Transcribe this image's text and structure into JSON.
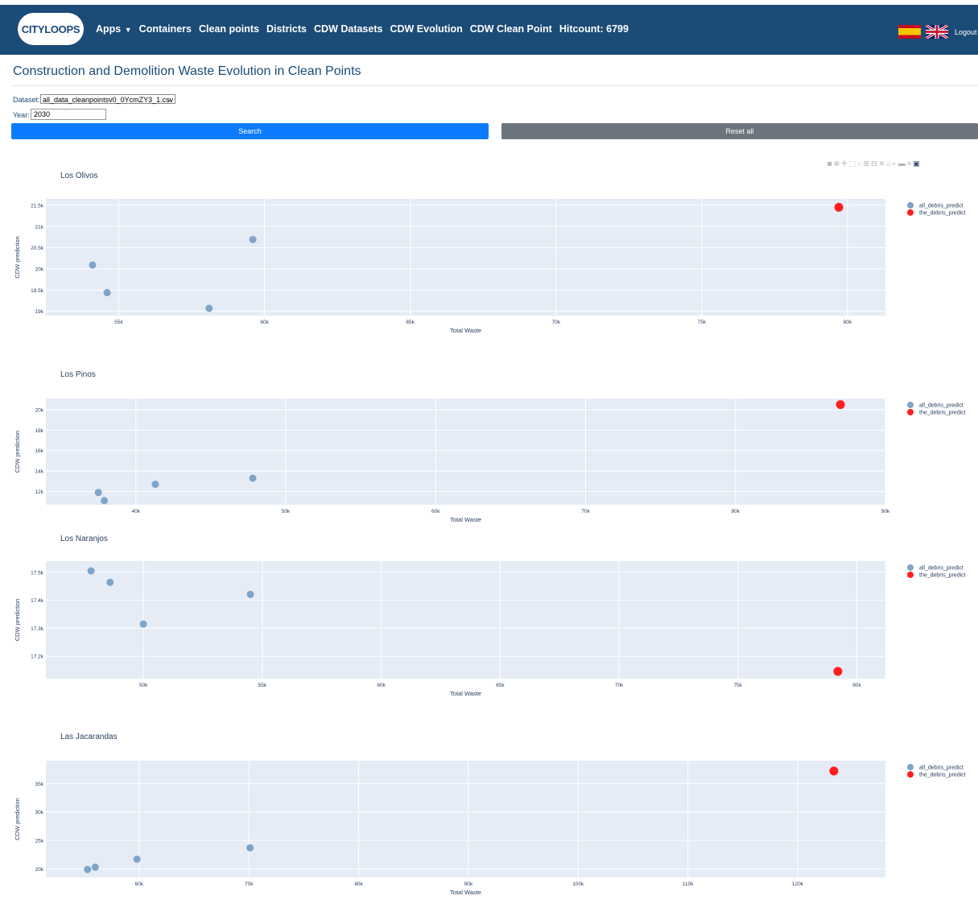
{
  "navbar": {
    "logo": "CITYLOOPS",
    "items": [
      "Apps",
      "Containers",
      "Clean points",
      "Districts",
      "CDW Datasets",
      "CDW Evolution",
      "CDW Clean Point",
      "Hitcount: 6799"
    ],
    "logout_label": "Logout",
    "flags": [
      "spain-flag",
      "uk-flag"
    ],
    "colors": {
      "navbar_bg": "#1b4b77"
    }
  },
  "page": {
    "title": "Construction and Demolition Waste Evolution in Clean Points"
  },
  "form": {
    "dataset_label": "Dataset:",
    "dataset_value": "all_data_cleanpointsv0_0YcmZY3_1.csv",
    "year_label": "Year:",
    "year_value": "2030",
    "search_label": "Search",
    "reset_label": "Reset all",
    "colors": {
      "search": "#0d7bff",
      "reset": "#6c757d"
    }
  },
  "chart_data": [
    {
      "type": "scatter",
      "title": "Los Olivos",
      "xlabel": "Total Waste",
      "ylabel": "CDW prediction",
      "xlim": [
        52500,
        81300
      ],
      "ylim": [
        18900,
        21650
      ],
      "xticks": [
        55000,
        60000,
        65000,
        70000,
        75000,
        80000
      ],
      "xtick_labels": [
        "55k",
        "60k",
        "65k",
        "70k",
        "75k",
        "80k"
      ],
      "yticks": [
        19000,
        19500,
        20000,
        20500,
        21000,
        21500
      ],
      "ytick_labels": [
        "19k",
        "19.5k",
        "20k",
        "20.5k",
        "21k",
        "21.5k"
      ],
      "legend": "right",
      "series": [
        {
          "name": "all_debris_predict",
          "color": "#7ea4c9",
          "x": [
            54100,
            54600,
            58100,
            59600
          ],
          "y": [
            20090,
            19440,
            19070,
            20690
          ]
        },
        {
          "name": "the_debris_predict",
          "color": "#ff1f1f",
          "x": [
            79700
          ],
          "y": [
            21450
          ]
        }
      ]
    },
    {
      "type": "scatter",
      "title": "Los Pinos",
      "xlabel": "Total Waste",
      "ylabel": "CDW prediction",
      "xlim": [
        34000,
        90000
      ],
      "ylim": [
        10700,
        21100
      ],
      "xticks": [
        40000,
        50000,
        60000,
        70000,
        80000,
        90000
      ],
      "xtick_labels": [
        "40k",
        "50k",
        "60k",
        "70k",
        "80k",
        "90k"
      ],
      "yticks": [
        12000,
        14000,
        16000,
        18000,
        20000
      ],
      "ytick_labels": [
        "12k",
        "14k",
        "16k",
        "18k",
        "20k"
      ],
      "legend": "right",
      "series": [
        {
          "name": "all_debris_predict",
          "color": "#7ea4c9",
          "x": [
            37500,
            37900,
            41300,
            47800
          ],
          "y": [
            11900,
            11100,
            12700,
            13300
          ]
        },
        {
          "name": "the_debris_predict",
          "color": "#ff1f1f",
          "x": [
            87000
          ],
          "y": [
            20500
          ]
        }
      ]
    },
    {
      "type": "scatter",
      "title": "Los Naranjos",
      "xlabel": "Total Waste",
      "ylabel": "CDW prediction",
      "xlim": [
        45900,
        81200
      ],
      "ylim": [
        17120,
        17540
      ],
      "xticks": [
        50000,
        55000,
        60000,
        65000,
        70000,
        75000,
        80000
      ],
      "xtick_labels": [
        "50k",
        "55k",
        "60k",
        "65k",
        "70k",
        "75k",
        "80k"
      ],
      "yticks": [
        17200,
        17300,
        17400,
        17500
      ],
      "ytick_labels": [
        "17.2k",
        "17.3k",
        "17.4k",
        "17.5k"
      ],
      "legend": "right",
      "series": [
        {
          "name": "all_debris_predict",
          "color": "#7ea4c9",
          "x": [
            47800,
            48600,
            50000,
            54500
          ],
          "y": [
            17505,
            17464,
            17315,
            17421
          ]
        },
        {
          "name": "the_debris_predict",
          "color": "#ff1f1f",
          "x": [
            79200
          ],
          "y": [
            17146
          ]
        }
      ]
    },
    {
      "type": "scatter",
      "title": "Las Jacarandas",
      "xlabel": "Total Waste",
      "ylabel": "CDW prediction",
      "xlim": [
        51500,
        128000
      ],
      "ylim": [
        18500,
        39000
      ],
      "xticks": [
        60000,
        70000,
        80000,
        90000,
        100000,
        110000,
        120000
      ],
      "xtick_labels": [
        "60k",
        "70k",
        "80k",
        "90k",
        "100k",
        "110k",
        "120k"
      ],
      "yticks": [
        20000,
        25000,
        30000,
        35000
      ],
      "ytick_labels": [
        "20k",
        "25k",
        "30k",
        "35k"
      ],
      "legend": "right",
      "series": [
        {
          "name": "all_debris_predict",
          "color": "#7ea4c9",
          "x": [
            55300,
            56000,
            59800,
            70100
          ],
          "y": [
            19900,
            20300,
            21700,
            23700
          ]
        },
        {
          "name": "the_debris_predict",
          "color": "#ff1f1f",
          "x": [
            123300
          ],
          "y": [
            37200
          ]
        }
      ]
    }
  ]
}
